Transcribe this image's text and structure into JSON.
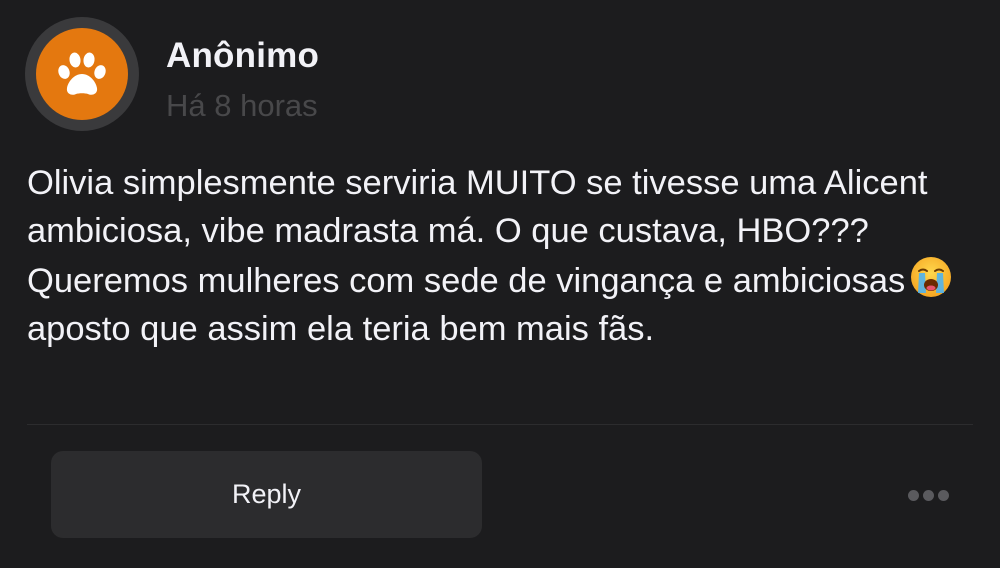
{
  "post": {
    "author": "Anônimo",
    "timestamp": "Há 8 horas",
    "text_before_emoji": "Olivia simplesmente serviria MUITO se tivesse uma Alicent ambiciosa, vibe madrasta má. O que custava, HBO??? Queremos mulheres com sede de vingança e ambiciosas",
    "text_after_emoji": "aposto que assim ela teria bem mais fãs.",
    "emoji": "loudly-crying-face-emoji"
  },
  "actions": {
    "reply_label": "Reply",
    "more_icon": "more-horizontal-icon"
  },
  "avatar": {
    "icon": "paw-print-icon",
    "color": "#e4780f"
  },
  "colors": {
    "background": "#1c1c1e",
    "button": "#2c2c2e",
    "text": "#f2f2f7",
    "muted": "#48484a"
  }
}
